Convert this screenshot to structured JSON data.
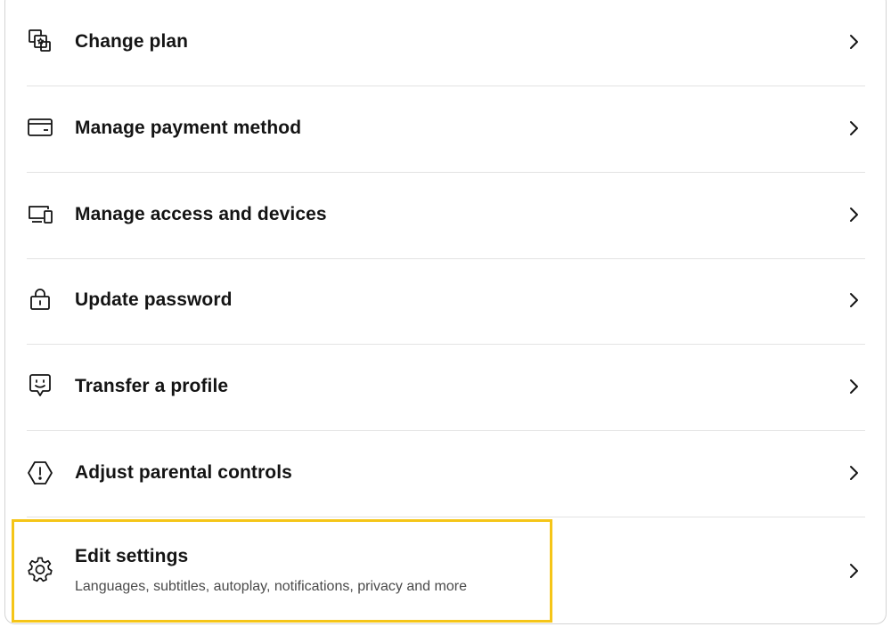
{
  "menu": {
    "items": [
      {
        "label": "Change plan",
        "icon": "change-plan-icon"
      },
      {
        "label": "Manage payment method",
        "icon": "credit-card-icon"
      },
      {
        "label": "Manage access and devices",
        "icon": "devices-icon"
      },
      {
        "label": "Update password",
        "icon": "lock-icon"
      },
      {
        "label": "Transfer a profile",
        "icon": "transfer-profile-icon"
      },
      {
        "label": "Adjust parental controls",
        "icon": "parental-controls-icon"
      },
      {
        "label": "Edit settings",
        "sublabel": "Languages, subtitles, autoplay, notifications, privacy and more",
        "icon": "gear-icon"
      }
    ],
    "chevron_icon": "chevron-right-icon"
  },
  "colors": {
    "text": "#141414",
    "subtext": "#4a4a4a",
    "divider": "#e3e3e3",
    "card_border": "#d4d4d4",
    "highlight": "#f5c518"
  }
}
